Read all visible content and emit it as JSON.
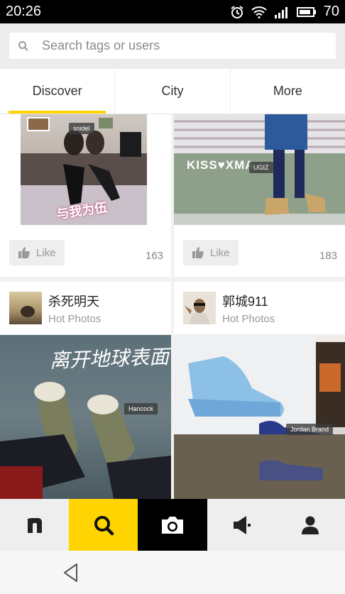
{
  "status": {
    "time": "20:26",
    "battery": "70"
  },
  "search": {
    "placeholder": "Search tags or users"
  },
  "tabs": [
    {
      "label": "Discover"
    },
    {
      "label": "City"
    },
    {
      "label": "More"
    }
  ],
  "cards": [
    {
      "tag": "snidel",
      "overlay_text": "与我为伍",
      "like_label": "Like",
      "count": "163"
    },
    {
      "tag": "UGIZ",
      "overlay_text": "KISS♥XMA",
      "like_label": "Like",
      "count": "183"
    }
  ],
  "users": [
    {
      "name": "杀死明天",
      "subtitle": "Hot Photos"
    },
    {
      "name": "郭城911",
      "subtitle": "Hot Photos"
    }
  ],
  "photos": [
    {
      "tag": "Hancock",
      "overlay_text": "离开地球表面"
    },
    {
      "tag": "Jordan Brand"
    }
  ],
  "nav": [
    {
      "icon": "home-n-icon"
    },
    {
      "icon": "search-icon"
    },
    {
      "icon": "camera-icon"
    },
    {
      "icon": "megaphone-icon"
    },
    {
      "icon": "profile-icon"
    }
  ],
  "colors": {
    "accent": "#ffd400",
    "camera_bg": "#000000"
  }
}
